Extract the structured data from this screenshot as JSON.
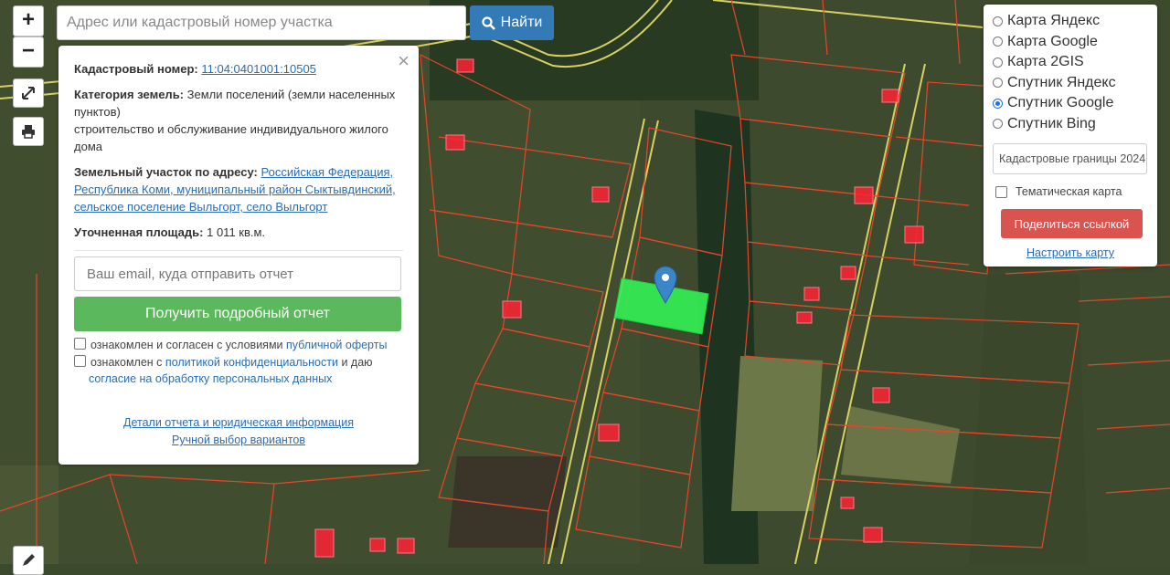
{
  "search": {
    "placeholder": "Адрес или кадастровый номер участка",
    "button_label": "Найти"
  },
  "map_controls": {
    "zoom_in": "+",
    "zoom_out": "−"
  },
  "info_panel": {
    "close": "×",
    "cadastral_label": "Кадастровый номер:",
    "cadastral_value": "11:04:0401001:10505",
    "category_label": "Категория земель:",
    "category_value": "Земли поселений (земли населенных пунктов)",
    "usage": "строительство и обслуживание индивидуального жилого дома",
    "address_label": "Земельный участок по адресу:",
    "address_value": "Российская Федерация, Республика Коми, муниципальный район Сыктывдинский, сельское поселение Выльгорт, село Выльгорт",
    "area_label": "Уточненная площадь:",
    "area_value": "1 011 кв.м.",
    "email_placeholder": "Ваш email, куда отправить отчет",
    "report_button": "Получить подробный отчет",
    "consent1_text": "ознакомлен и согласен с условиями",
    "consent1_link": "публичной оферты",
    "consent2_text1": "ознакомлен с",
    "consent2_link1": "политикой конфиденциальности",
    "consent2_text2": "и даю",
    "consent2_link2": "согласие на обработку персональных данных",
    "details_link": "Детали отчета и юридическая информация",
    "manual_link": "Ручной выбор вариантов"
  },
  "layers": {
    "options": [
      {
        "label": "Карта Яндекс",
        "selected": false
      },
      {
        "label": "Карта Google",
        "selected": false
      },
      {
        "label": "Карта 2GIS",
        "selected": false
      },
      {
        "label": "Спутник Яндекс",
        "selected": false
      },
      {
        "label": "Спутник Google",
        "selected": true
      },
      {
        "label": "Спутник Bing",
        "selected": false
      }
    ],
    "select_value": "Кадастровые границы 2024",
    "thematic_label": "Тематическая карта",
    "share_button": "Поделиться ссылкой",
    "configure_link": "Настроить карту"
  },
  "colors": {
    "highlight": "#33ee55",
    "boundary": "#e8452a",
    "road": "#d8d060",
    "marker": "#3a86c8"
  }
}
